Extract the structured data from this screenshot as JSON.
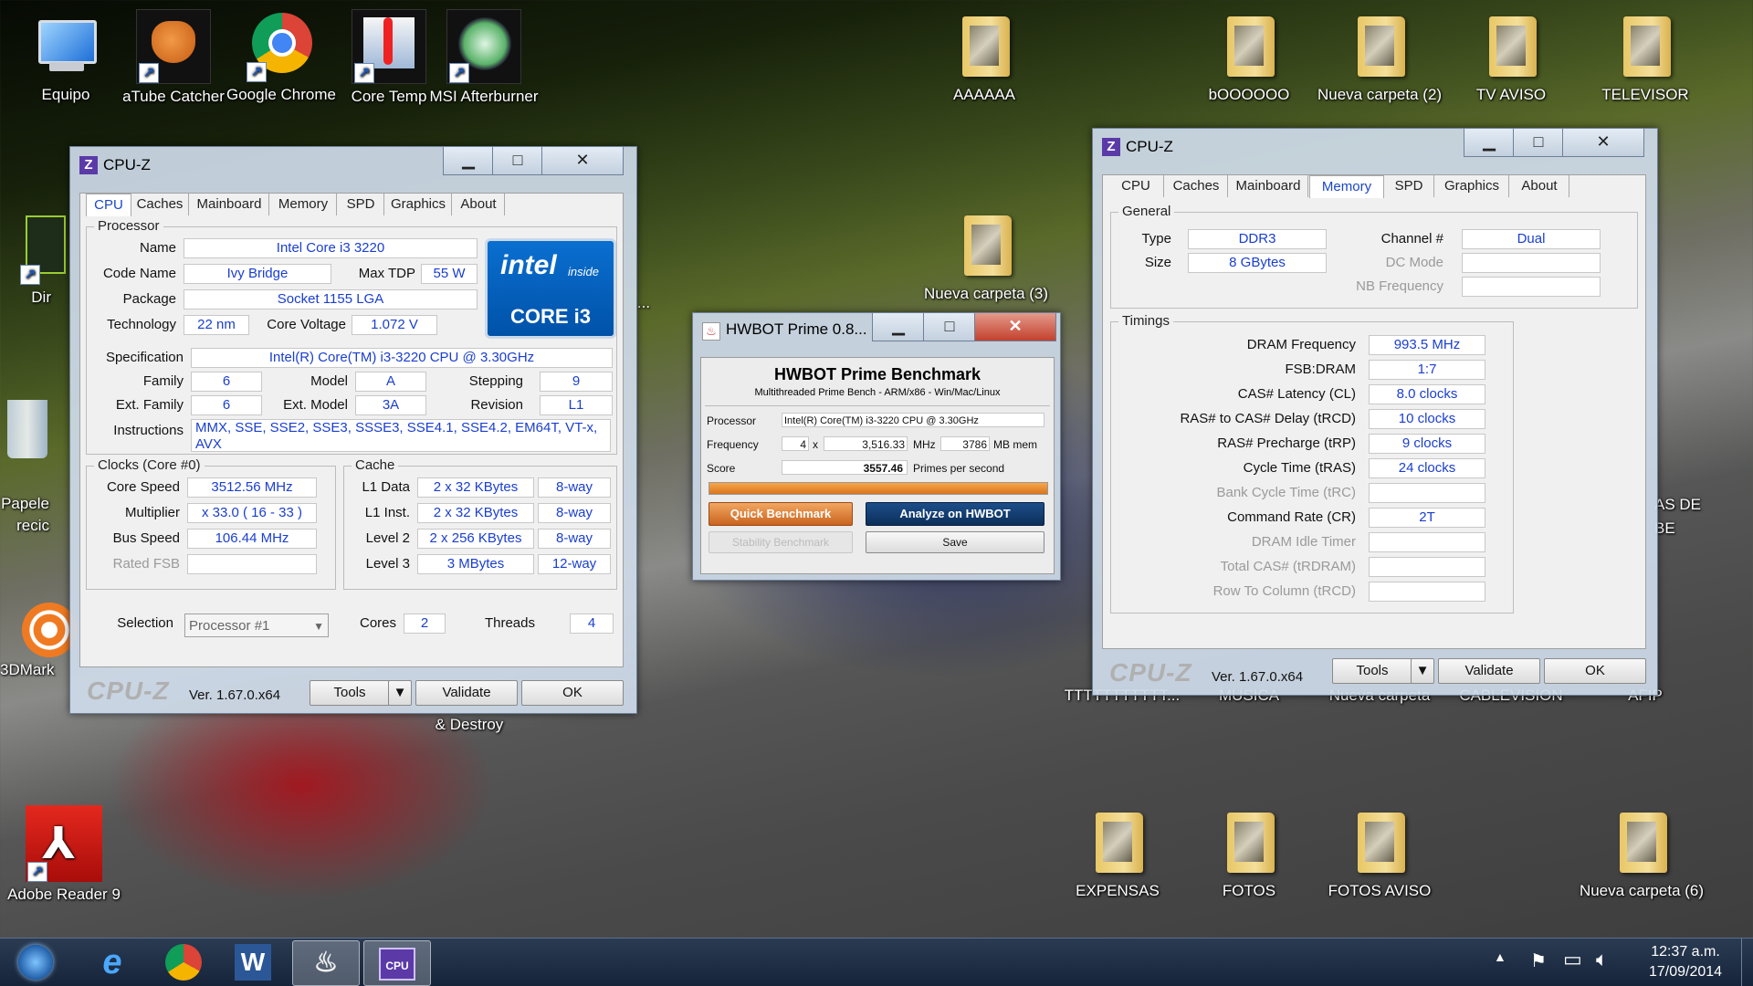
{
  "desktop": {
    "icons": [
      {
        "id": "equipo",
        "label": "Equipo",
        "icon": "computer-icon"
      },
      {
        "id": "atube",
        "label": "aTube Catcher",
        "icon": "catcher-glove-icon"
      },
      {
        "id": "chrome",
        "label": "Google Chrome",
        "icon": "chrome-icon"
      },
      {
        "id": "coretemp",
        "label": "Core Temp",
        "icon": "thermometer-icon"
      },
      {
        "id": "msi",
        "label": "MSI Afterburner",
        "icon": "afterburner-icon"
      },
      {
        "id": "aaaaaa",
        "label": "AAAAAA",
        "icon": "folder-icon"
      },
      {
        "id": "boooooo",
        "label": "bOOOOOO",
        "icon": "folder-icon"
      },
      {
        "id": "nueva2",
        "label": "Nueva carpeta (2)",
        "icon": "folder-icon"
      },
      {
        "id": "tvaviso",
        "label": "TV AVISO",
        "icon": "folder-icon"
      },
      {
        "id": "televisor",
        "label": "TELEVISOR",
        "icon": "folder-icon"
      },
      {
        "id": "nueva3",
        "label": "Nueva carpeta (3)",
        "icon": "folder-icon"
      },
      {
        "id": "dir",
        "label": "Dir",
        "icon": "shortcut-icon"
      },
      {
        "id": "papelera",
        "label": "Papele\nrecic",
        "icon": "recycle-bin-icon"
      },
      {
        "id": "3dmark",
        "label": "3DMark",
        "icon": "3dmark-icon"
      },
      {
        "id": "destroy",
        "label": "& Destroy",
        "icon": ""
      },
      {
        "id": "asde",
        "label": "AS DE\nBE",
        "icon": ""
      },
      {
        "id": "ttt",
        "label": "TTTTTTTTTTT...",
        "icon": "folder-icon"
      },
      {
        "id": "musica",
        "label": "MUSICA",
        "icon": "folder-icon"
      },
      {
        "id": "nuevacarpeta",
        "label": "Nueva carpeta",
        "icon": "folder-icon"
      },
      {
        "id": "cablevision",
        "label": "CABLEVISION",
        "icon": "folder-icon"
      },
      {
        "id": "afip",
        "label": "AFIP",
        "icon": "folder-icon"
      },
      {
        "id": "adobe",
        "label": "Adobe Reader 9",
        "icon": "adobe-reader-icon"
      },
      {
        "id": "expensas",
        "label": "EXPENSAS",
        "icon": "folder-icon"
      },
      {
        "id": "fotos",
        "label": "FOTOS",
        "icon": "folder-icon"
      },
      {
        "id": "fotosaviso",
        "label": "FOTOS AVISO",
        "icon": "folder-icon"
      },
      {
        "id": "nueva6",
        "label": "Nueva carpeta (6)",
        "icon": "folder-icon"
      },
      {
        "id": "dots",
        "label": "...",
        "icon": ""
      }
    ]
  },
  "cpuz1": {
    "title": "CPU-Z",
    "tabs": [
      "CPU",
      "Caches",
      "Mainboard",
      "Memory",
      "SPD",
      "Graphics",
      "About"
    ],
    "processor": {
      "group": "Processor",
      "name_l": "Name",
      "name": "Intel Core i3 3220",
      "code_l": "Code Name",
      "code": "Ivy Bridge",
      "tdp_l": "Max TDP",
      "tdp": "55 W",
      "package_l": "Package",
      "package": "Socket 1155 LGA",
      "tech_l": "Technology",
      "tech": "22 nm",
      "volt_l": "Core Voltage",
      "volt": "1.072 V",
      "spec_l": "Specification",
      "spec": "Intel(R) Core(TM) i3-3220 CPU @ 3.30GHz",
      "family_l": "Family",
      "family": "6",
      "model_l": "Model",
      "model": "A",
      "stepping_l": "Stepping",
      "stepping": "9",
      "extfam_l": "Ext. Family",
      "extfam": "6",
      "extmodel_l": "Ext. Model",
      "extmodel": "3A",
      "rev_l": "Revision",
      "rev": "L1",
      "instr_l": "Instructions",
      "instr": "MMX, SSE, SSE2, SSE3, SSSE3, SSE4.1, SSE4.2, EM64T, VT-x, AVX",
      "logo_intel": "intel",
      "logo_inside": "inside",
      "logo_core": "CORE i3"
    },
    "clocks": {
      "group": "Clocks (Core #0)",
      "speed_l": "Core Speed",
      "speed": "3512.56 MHz",
      "mult_l": "Multiplier",
      "mult": "x 33.0 ( 16 - 33 )",
      "bus_l": "Bus Speed",
      "bus": "106.44 MHz",
      "fsb_l": "Rated FSB",
      "fsb": ""
    },
    "cache": {
      "group": "Cache",
      "rows": [
        {
          "l": "L1 Data",
          "size": "2 x 32 KBytes",
          "way": "8-way"
        },
        {
          "l": "L1 Inst.",
          "size": "2 x 32 KBytes",
          "way": "8-way"
        },
        {
          "l": "Level 2",
          "size": "2 x 256 KBytes",
          "way": "8-way"
        },
        {
          "l": "Level 3",
          "size": "3 MBytes",
          "way": "12-way"
        }
      ]
    },
    "selection_l": "Selection",
    "selection": "Processor #1",
    "cores_l": "Cores",
    "cores": "2",
    "threads_l": "Threads",
    "threads": "4",
    "footer": {
      "logo": "CPU-Z",
      "ver": "Ver. 1.67.0.x64",
      "tools": "Tools",
      "validate": "Validate",
      "ok": "OK"
    }
  },
  "cpuz2": {
    "title": "CPU-Z",
    "tabs": [
      "CPU",
      "Caches",
      "Mainboard",
      "Memory",
      "SPD",
      "Graphics",
      "About"
    ],
    "general": {
      "group": "General",
      "type_l": "Type",
      "type": "DDR3",
      "size_l": "Size",
      "size": "8 GBytes",
      "channel_l": "Channel #",
      "channel": "Dual",
      "dc_l": "DC Mode",
      "dc": "",
      "nb_l": "NB Frequency",
      "nb": ""
    },
    "timings": {
      "group": "Timings",
      "rows": [
        {
          "l": "DRAM Frequency",
          "v": "993.5 MHz",
          "dim": false
        },
        {
          "l": "FSB:DRAM",
          "v": "1:7",
          "dim": false
        },
        {
          "l": "CAS# Latency (CL)",
          "v": "8.0 clocks",
          "dim": false
        },
        {
          "l": "RAS# to CAS# Delay (tRCD)",
          "v": "10 clocks",
          "dim": false
        },
        {
          "l": "RAS# Precharge (tRP)",
          "v": "9 clocks",
          "dim": false
        },
        {
          "l": "Cycle Time (tRAS)",
          "v": "24 clocks",
          "dim": false
        },
        {
          "l": "Bank Cycle Time (tRC)",
          "v": "",
          "dim": true
        },
        {
          "l": "Command Rate (CR)",
          "v": "2T",
          "dim": false
        },
        {
          "l": "DRAM Idle Timer",
          "v": "",
          "dim": true
        },
        {
          "l": "Total CAS# (tRDRAM)",
          "v": "",
          "dim": true
        },
        {
          "l": "Row To Column (tRCD)",
          "v": "",
          "dim": true
        }
      ]
    },
    "footer": {
      "logo": "CPU-Z",
      "ver": "Ver. 1.67.0.x64",
      "tools": "Tools",
      "validate": "Validate",
      "ok": "OK"
    }
  },
  "hwbot": {
    "title": "HWBOT Prime 0.8...",
    "heading": "HWBOT Prime Benchmark",
    "sub": "Multithreaded Prime Bench - ARM/x86 - Win/Mac/Linux",
    "proc_l": "Processor",
    "proc": "Intel(R) Core(TM) i3-3220 CPU @ 3.30GHz",
    "freq_l": "Frequency",
    "threads": "4",
    "x": "x",
    "mhz": "3,516.33",
    "mhz_u": "MHz",
    "mem": "3786",
    "mem_u": "MB mem",
    "score_l": "Score",
    "score": "3557.46",
    "score_u": "Primes per second",
    "quick": "Quick Benchmark",
    "analyze": "Analyze on HWBOT",
    "stability": "Stability Benchmark",
    "save": "Save",
    "progress": 1.0
  },
  "taskbar": {
    "apps": [
      "windows-start",
      "internet-explorer",
      "chrome",
      "word",
      "java-hwbot",
      "cpuz"
    ],
    "time": "12:37 a.m.",
    "date": "17/09/2014"
  }
}
